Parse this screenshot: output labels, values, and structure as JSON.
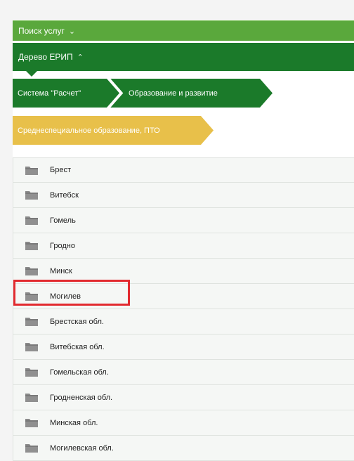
{
  "search_bar": {
    "label": "Поиск услуг",
    "chevron": "⌄"
  },
  "tree_bar": {
    "label": "Дерево ЕРИП",
    "chevron": "⌃"
  },
  "breadcrumbs": [
    {
      "label": "Система \"Расчет\"",
      "color": "#1b7a2a"
    },
    {
      "label": "Образование и развитие",
      "color": "#1b7a2a"
    },
    {
      "label": "Среднеспециальное образование, ПТО",
      "color": "#e8c04a"
    }
  ],
  "folder_icon": "folder-icon",
  "items": [
    {
      "label": "Брест"
    },
    {
      "label": "Витебск"
    },
    {
      "label": "Гомель"
    },
    {
      "label": "Гродно"
    },
    {
      "label": "Минск"
    },
    {
      "label": "Могилев",
      "highlighted": true
    },
    {
      "label": "Брестская обл."
    },
    {
      "label": "Витебская обл."
    },
    {
      "label": "Гомельская обл."
    },
    {
      "label": "Гродненская обл."
    },
    {
      "label": "Минская обл."
    },
    {
      "label": "Могилевская обл."
    }
  ],
  "colors": {
    "green_light": "#5aa83c",
    "green_dark": "#1b7a2a",
    "yellow": "#e8c04a",
    "highlight_red": "#e22a2f"
  }
}
